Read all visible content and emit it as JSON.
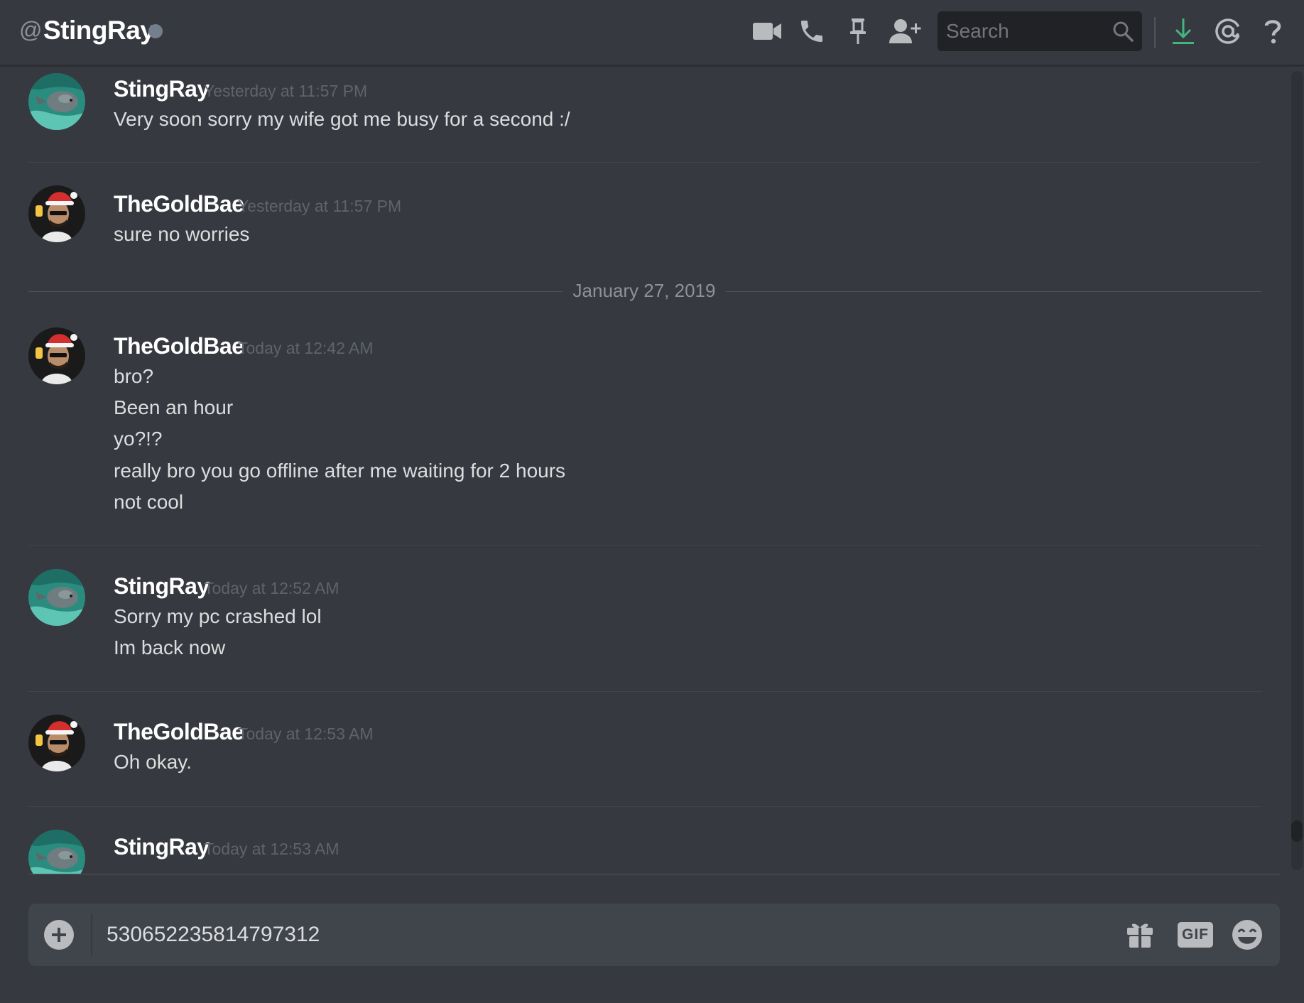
{
  "header": {
    "at_symbol": "@",
    "channel_name": "StingRay",
    "search_placeholder": "Search",
    "icons": [
      "video-call-icon",
      "voice-call-icon",
      "pin-icon",
      "add-friend-icon",
      "search-icon",
      "download-icon",
      "mention-icon",
      "help-icon"
    ],
    "status_color": "#747f8d",
    "download_color": "#43b581"
  },
  "messages": [
    {
      "author": "StingRay",
      "timestamp": "Yesterday at 11:57 PM",
      "lines": [
        "Very soon sorry my wife got me busy for a second :/"
      ]
    },
    {
      "author": "TheGoldBae",
      "timestamp": "Yesterday at 11:57 PM",
      "lines": [
        "sure no worries"
      ]
    },
    {
      "author": "TheGoldBae",
      "timestamp": "Today at 12:42 AM",
      "lines": [
        "bro?",
        "Been an hour",
        "yo?!?",
        "really bro you go offline after me waiting for 2 hours",
        "not cool"
      ]
    },
    {
      "author": "StingRay",
      "timestamp": "Today at 12:52 AM",
      "lines": [
        "Sorry my pc crashed lol",
        "Im back now"
      ]
    },
    {
      "author": "TheGoldBae",
      "timestamp": "Today at 12:53 AM",
      "lines": [
        "Oh okay."
      ]
    },
    {
      "author": "StingRay",
      "timestamp": "Today at 12:53 AM",
      "lines": []
    }
  ],
  "date_divider": "January 27, 2019",
  "composer": {
    "value": "530652235814797312",
    "gif_label": "GIF",
    "icons": [
      "add-attachment-icon",
      "gift-icon",
      "gif-icon",
      "emoji-icon"
    ]
  }
}
